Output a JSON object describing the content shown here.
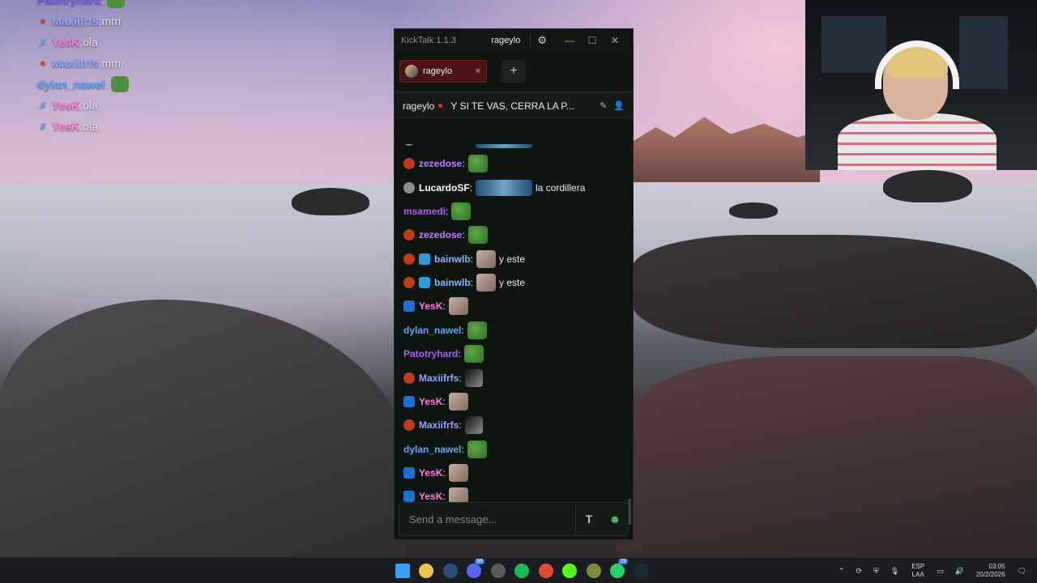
{
  "overlay_chat": [
    {
      "user": "Patotryhard",
      "color": "#7a5cf0",
      "badge": "none",
      "text": ""
    },
    {
      "user": "Maxiifrfs",
      "color": "#8ea7ff",
      "badge": "red",
      "text": "mm"
    },
    {
      "user": "YesK",
      "color": "#ff7be0",
      "badge": "blue",
      "text": "ola"
    },
    {
      "user": "Maxiifrfs",
      "color": "#8ea7ff",
      "badge": "red",
      "text": "mm"
    },
    {
      "user": "dylan_nawel",
      "color": "#61a5ff",
      "badge": "none",
      "text": ""
    },
    {
      "user": "YesK",
      "color": "#ff7be0",
      "badge": "blue",
      "text": "ola"
    },
    {
      "user": "YesK",
      "color": "#ff7be0",
      "badge": "blue",
      "text": "ola"
    }
  ],
  "window": {
    "app_title": "KickTalk 1.1.3",
    "user": "rageylo",
    "gear_icon": "gear-icon",
    "minimize": "—",
    "maximize": "☐",
    "close": "✕"
  },
  "tabs": [
    {
      "label": "rageylo",
      "close": "✕"
    }
  ],
  "add_tab_label": "+",
  "streamer": {
    "name": "rageylo",
    "stream_title": "Y SI TE VAS, CERRA LA P..."
  },
  "chat": {
    "messages": [
      {
        "user": "LucardoSF",
        "color": "#ffffff",
        "badges": [
          "gray"
        ],
        "emote": "car",
        "text": "la cordillera"
      },
      {
        "user": "zezedose",
        "color": "#b882ff",
        "badges": [
          "red"
        ],
        "emote": "pepe",
        "text": ""
      },
      {
        "user": "LucardoSF",
        "color": "#ffffff",
        "badges": [
          "gray"
        ],
        "emote": "car",
        "text": "la cordillera"
      },
      {
        "user": "msamedi",
        "color": "#b35cff",
        "badges": [],
        "emote": "pepe",
        "text": ""
      },
      {
        "user": "zezedose",
        "color": "#b882ff",
        "badges": [
          "red"
        ],
        "emote": "pepe",
        "text": ""
      },
      {
        "user": "bainwlb",
        "color": "#8ab4ff",
        "badges": [
          "red",
          "cube"
        ],
        "emote": "cat",
        "text": "y este"
      },
      {
        "user": "bainwlb",
        "color": "#8ab4ff",
        "badges": [
          "red",
          "cube"
        ],
        "emote": "cat",
        "text": "y este"
      },
      {
        "user": "YesK",
        "color": "#ff7be0",
        "badges": [
          "blue"
        ],
        "emote": "cat",
        "text": ""
      },
      {
        "user": "dylan_nawel",
        "color": "#61a5ff",
        "badges": [],
        "emote": "pepe",
        "text": ""
      },
      {
        "user": "Patotryhard",
        "color": "#b35cff",
        "badges": [],
        "emote": "pepe",
        "text": ""
      },
      {
        "user": "Maxiifrfs",
        "color": "#8ea7ff",
        "badges": [
          "red"
        ],
        "emote": "dark",
        "text": ""
      },
      {
        "user": "YesK",
        "color": "#ff7be0",
        "badges": [
          "blue"
        ],
        "emote": "cat",
        "text": ""
      },
      {
        "user": "Maxiifrfs",
        "color": "#8ea7ff",
        "badges": [
          "red"
        ],
        "emote": "dark",
        "text": ""
      },
      {
        "user": "dylan_nawel",
        "color": "#61a5ff",
        "badges": [],
        "emote": "pepe",
        "text": ""
      },
      {
        "user": "YesK",
        "color": "#ff7be0",
        "badges": [
          "blue"
        ],
        "emote": "cat",
        "text": ""
      },
      {
        "user": "YesK",
        "color": "#ff7be0",
        "badges": [
          "blue"
        ],
        "emote": "cat",
        "text": ""
      }
    ]
  },
  "input": {
    "placeholder": "Send a message...",
    "translate_icon": "translate-icon",
    "emoji_icon": "emoji-icon"
  },
  "taskbar": {
    "apps": [
      {
        "name": "windows-start-icon",
        "color": "#3aa0f5"
      },
      {
        "name": "file-explorer-icon",
        "color": "#f2c14e"
      },
      {
        "name": "steam-icon",
        "color": "#2a4e78"
      },
      {
        "name": "discord-icon",
        "color": "#5865f2",
        "badge": "99"
      },
      {
        "name": "obs-icon",
        "color": "#5a5a5a"
      },
      {
        "name": "spotify-icon",
        "color": "#1db954"
      },
      {
        "name": "chrome-icon",
        "color": "#e24a3b"
      },
      {
        "name": "kick-icon",
        "color": "#53fc18"
      },
      {
        "name": "minecraft-icon",
        "color": "#7a8c3a"
      },
      {
        "name": "whatsapp-icon",
        "color": "#25d366",
        "badge": "29"
      },
      {
        "name": "steam-icon-2",
        "color": "#1b2838"
      }
    ],
    "language": "ESP",
    "layout": "LAA",
    "time": "03:05",
    "date": "20/2/2026"
  }
}
